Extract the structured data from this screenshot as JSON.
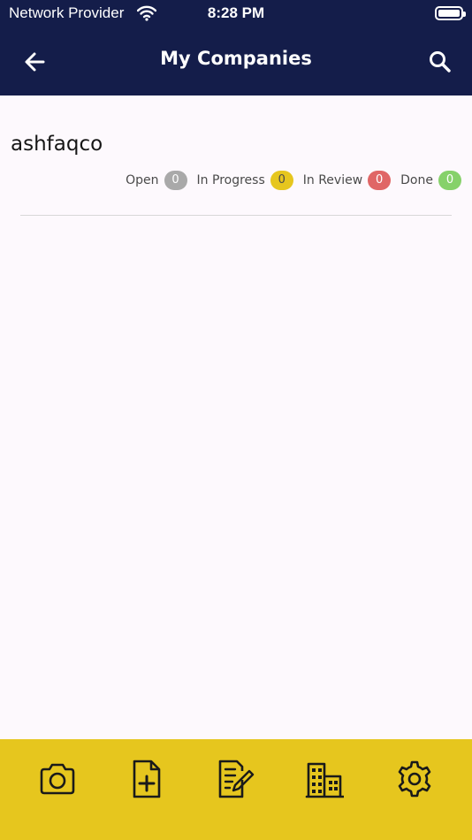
{
  "status_bar": {
    "carrier": "Network Provider",
    "time": "8:28 PM"
  },
  "nav": {
    "title": "My Companies",
    "back_icon": "arrow-left-icon",
    "search_icon": "search-icon"
  },
  "company": {
    "name": "ashfaqco",
    "statuses": [
      {
        "label": "Open",
        "count": "0",
        "color": "#a9a9a9",
        "text_color": "#ffffff"
      },
      {
        "label": "In Progress",
        "count": "0",
        "color": "#e6c61e",
        "text_color": "#4a4a4a"
      },
      {
        "label": "In Review",
        "count": "0",
        "color": "#e06666",
        "text_color": "#ffffff"
      },
      {
        "label": "Done",
        "count": "0",
        "color": "#86d16a",
        "text_color": "#ffffff"
      }
    ]
  },
  "toolbar": {
    "icons": [
      "camera-icon",
      "add-document-icon",
      "edit-document-icon",
      "buildings-icon",
      "settings-gear-icon"
    ]
  },
  "colors": {
    "header_bg": "#141d4a",
    "toolbar_bg": "#e6c61e",
    "page_bg": "#fdf9fd"
  }
}
